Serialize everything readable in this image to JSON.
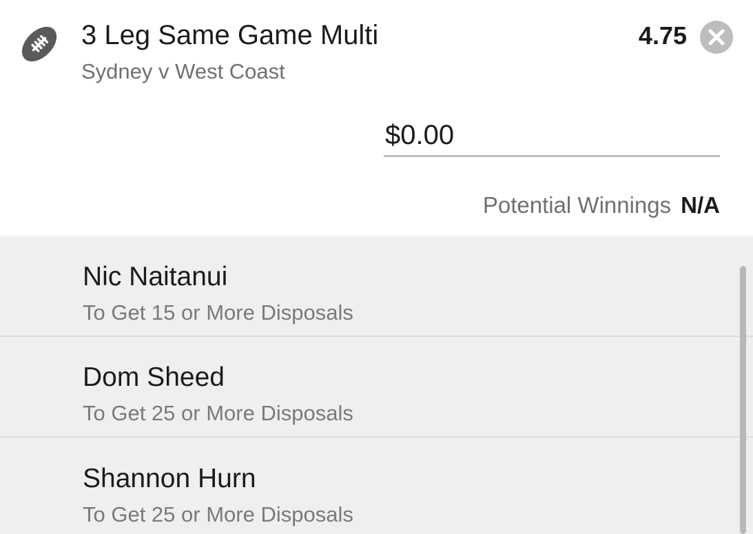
{
  "bet": {
    "title": "3 Leg Same Game Multi",
    "match": "Sydney v West Coast",
    "odds": "4.75",
    "icon": "football-icon",
    "close_icon": "close-icon"
  },
  "stake": {
    "value": "$0.00"
  },
  "winnings": {
    "label": "Potential Winnings",
    "value": "N/A"
  },
  "legs": [
    {
      "player": "Nic Naitanui",
      "market": "To Get 15 or More Disposals"
    },
    {
      "player": "Dom Sheed",
      "market": "To Get 25 or More Disposals"
    },
    {
      "player": "Shannon Hurn",
      "market": "To Get 25 or More Disposals"
    }
  ],
  "colors": {
    "text_primary": "#1b1b1b",
    "text_secondary": "#707070",
    "legs_background": "#efefef",
    "icon": "#5a5a5a",
    "close_button": "#bdbdbd"
  }
}
